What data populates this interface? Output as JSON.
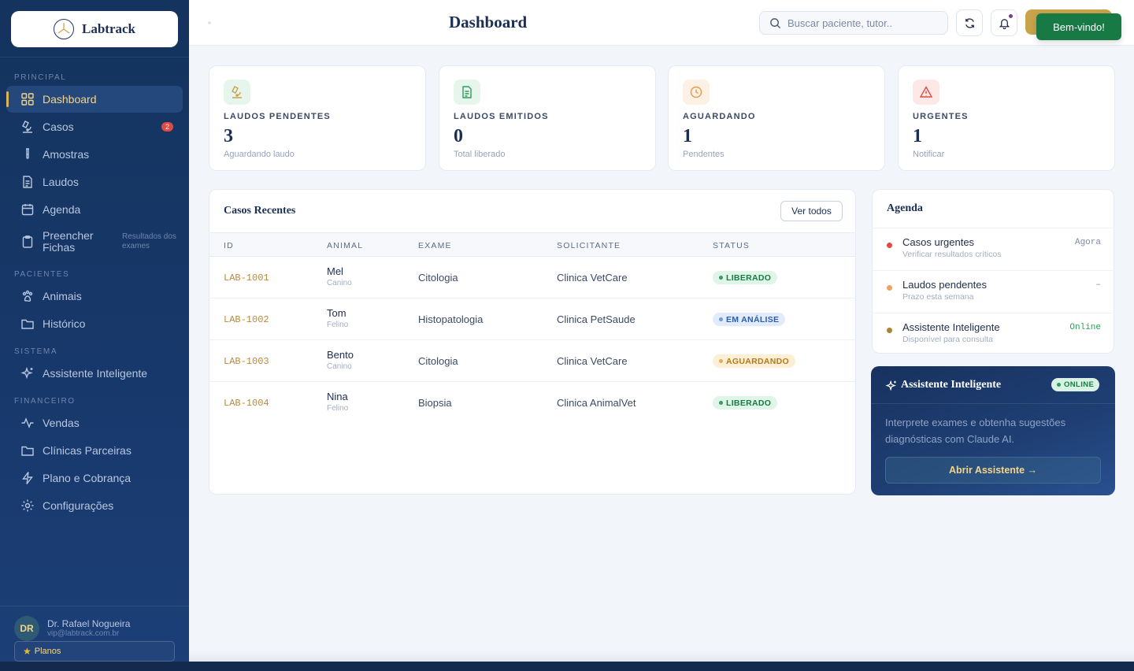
{
  "app": {
    "logo_text": "Labtrack",
    "page_title": "Dashboard"
  },
  "sidebar": {
    "sections": {
      "principal": "PRINCIPAL",
      "pacientes": "PACIENTES",
      "sistema": "SISTEMA",
      "financeiro": "FINANCEIRO"
    },
    "items": [
      {
        "label": "Dashboard",
        "icon": "grid-icon",
        "active": true
      },
      {
        "label": "Casos",
        "icon": "microscope-icon",
        "badge": "2"
      },
      {
        "label": "Amostras",
        "icon": "test-tube-icon"
      },
      {
        "label": "Laudos",
        "icon": "document-icon"
      },
      {
        "label": "Agenda",
        "icon": "calendar-icon"
      },
      {
        "label": "Preencher Fichas",
        "icon": "clipboard-icon",
        "sub": "Resultados dos exames"
      },
      {
        "label": "Animais",
        "icon": "paw-icon"
      },
      {
        "label": "Histórico",
        "icon": "folder-icon"
      },
      {
        "label": "Assistente Inteligente",
        "icon": "sparkle-icon"
      },
      {
        "label": "Vendas",
        "icon": "activity-icon"
      },
      {
        "label": "Clínicas Parceiras",
        "icon": "folder-icon"
      },
      {
        "label": "Plano e Cobrança",
        "icon": "bolt-icon"
      },
      {
        "label": "Configurações",
        "icon": "gear-icon"
      }
    ],
    "user": {
      "initials": "DR",
      "name": "Dr. Rafael Nogueira",
      "email": "vip@labtrack.com.br",
      "plan_label": "Planos"
    }
  },
  "topbar": {
    "search_placeholder": "Buscar paciente, tutor..",
    "toast": "Bem-vindo!"
  },
  "stats": [
    {
      "label": "LAUDOS PENDENTES",
      "value": "3",
      "sub": "Aguardando laudo",
      "icon": "microscope-icon",
      "color": "#2e9e5b",
      "bg": "#e6f6ec"
    },
    {
      "label": "LAUDOS EMITIDOS",
      "value": "0",
      "sub": "Total liberado",
      "icon": "document-icon",
      "color": "#2e9e5b",
      "bg": "#e6f6ec"
    },
    {
      "label": "AGUARDANDO",
      "value": "1",
      "sub": "Pendentes",
      "icon": "clock-icon",
      "color": "#e59a4c",
      "bg": "#fdf0e4"
    },
    {
      "label": "URGENTES",
      "value": "1",
      "sub": "Notificar",
      "icon": "alert-icon",
      "color": "#e04a42",
      "bg": "#fde8e7"
    }
  ],
  "cases": {
    "title": "Casos Recentes",
    "view_all": "Ver todos",
    "columns": [
      "ID",
      "ANIMAL",
      "EXAME",
      "SOLICITANTE",
      "STATUS"
    ],
    "rows": [
      {
        "id": "LAB-1001",
        "animal": "Mel",
        "species": "Canino",
        "exam": "Citologia",
        "requester": "Clinica VetCare",
        "status": "LIBERADO",
        "status_kind": "liberado"
      },
      {
        "id": "LAB-1002",
        "animal": "Tom",
        "species": "Felino",
        "exam": "Histopatologia",
        "requester": "Clinica PetSaude",
        "status": "EM ANÁLISE",
        "status_kind": "analise"
      },
      {
        "id": "LAB-1003",
        "animal": "Bento",
        "species": "Canino",
        "exam": "Citologia",
        "requester": "Clinica VetCare",
        "status": "AGUARDANDO",
        "status_kind": "aguardando"
      },
      {
        "id": "LAB-1004",
        "animal": "Nina",
        "species": "Felino",
        "exam": "Biopsia",
        "requester": "Clinica AnimalVet",
        "status": "LIBERADO",
        "status_kind": "liberado"
      }
    ]
  },
  "agenda": {
    "title": "Agenda",
    "items": [
      {
        "title": "Casos urgentes",
        "sub": "Verificar resultados críticos",
        "right": "Agora",
        "dot": "#e04a42"
      },
      {
        "title": "Laudos pendentes",
        "sub": "Prazo esta semana",
        "right": "–",
        "dot": "#f0a062"
      },
      {
        "title": "Assistente Inteligente",
        "sub": "Disponível para consulta",
        "right": "Online",
        "dot": "#a8862e",
        "right_color": "#2e9e5b"
      }
    ]
  },
  "assistant": {
    "title": "Assistente Inteligente",
    "status": "ONLINE",
    "text": "Interprete exames e obtenha sugestões diagnósticas com Claude AI.",
    "button": "Abrir Assistente →"
  },
  "colors": {
    "liberado_bg": "#dff5e8",
    "liberado_fg": "#177a45",
    "analise_bg": "#e1ebfb",
    "analise_fg": "#2b5ea8",
    "aguardando_bg": "#fcefd5",
    "aguardando_fg": "#b47a1a"
  }
}
